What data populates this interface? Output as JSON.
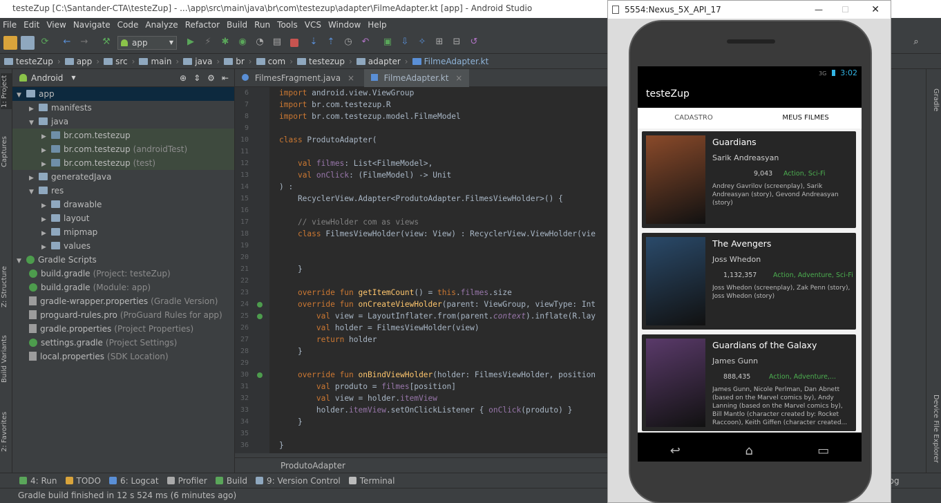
{
  "window": {
    "title": "testeZup [C:\\Santander-CTA\\testeZup] - ...\\app\\src\\main\\java\\br\\com\\testezup\\adapter\\FilmeAdapter.kt [app] - Android Studio",
    "minimize": "—",
    "maximize": "☐",
    "close": "✕"
  },
  "menu": [
    "File",
    "Edit",
    "View",
    "Navigate",
    "Code",
    "Analyze",
    "Refactor",
    "Build",
    "Run",
    "Tools",
    "VCS",
    "Window",
    "Help"
  ],
  "toolbar": {
    "run_config": "app"
  },
  "breadcrumb": [
    "testeZup",
    "app",
    "src",
    "main",
    "java",
    "br",
    "com",
    "testezup",
    "adapter",
    "FilmeAdapter.kt"
  ],
  "left_stripe": {
    "project": "1: Project",
    "captures": "Captures",
    "structure": "Z: Structure",
    "build_variants": "Build Variants",
    "favorites": "2: Favorites"
  },
  "project_panel": {
    "view_mode": "Android",
    "tree": [
      {
        "label": "app",
        "muted": "",
        "icon": "folder-icon",
        "indent": 0,
        "arrow": "▼"
      },
      {
        "label": "manifests",
        "muted": "",
        "icon": "folder-icon",
        "indent": 1,
        "arrow": "▶"
      },
      {
        "label": "java",
        "muted": "",
        "icon": "folder-icon",
        "indent": 1,
        "arrow": "▼"
      },
      {
        "label": "br.com.testezup",
        "muted": "",
        "icon": "package-icon",
        "indent": 2,
        "arrow": "▶"
      },
      {
        "label": "br.com.testezup",
        "muted": "(androidTest)",
        "icon": "package-icon",
        "indent": 2,
        "arrow": "▶"
      },
      {
        "label": "br.com.testezup",
        "muted": "(test)",
        "icon": "package-icon",
        "indent": 2,
        "arrow": "▶"
      },
      {
        "label": "generatedJava",
        "muted": "",
        "icon": "folder-icon",
        "indent": 1,
        "arrow": "▶"
      },
      {
        "label": "res",
        "muted": "",
        "icon": "folder-icon",
        "indent": 1,
        "arrow": "▼"
      },
      {
        "label": "drawable",
        "muted": "",
        "icon": "folder-icon",
        "indent": 2,
        "arrow": "▶"
      },
      {
        "label": "layout",
        "muted": "",
        "icon": "folder-icon",
        "indent": 2,
        "arrow": "▶"
      },
      {
        "label": "mipmap",
        "muted": "",
        "icon": "folder-icon",
        "indent": 2,
        "arrow": "▶"
      },
      {
        "label": "values",
        "muted": "",
        "icon": "folder-icon",
        "indent": 2,
        "arrow": "▶"
      },
      {
        "label": "Gradle Scripts",
        "muted": "",
        "icon": "gradle-icon",
        "indent": 0,
        "arrow": "▼"
      },
      {
        "label": "build.gradle",
        "muted": "(Project: testeZup)",
        "icon": "gradle-icon",
        "indent": 1,
        "arrow": ""
      },
      {
        "label": "build.gradle",
        "muted": "(Module: app)",
        "icon": "gradle-icon",
        "indent": 1,
        "arrow": ""
      },
      {
        "label": "gradle-wrapper.properties",
        "muted": "(Gradle Version)",
        "icon": "properties-icon",
        "indent": 1,
        "arrow": ""
      },
      {
        "label": "proguard-rules.pro",
        "muted": "(ProGuard Rules for app)",
        "icon": "properties-icon",
        "indent": 1,
        "arrow": ""
      },
      {
        "label": "gradle.properties",
        "muted": "(Project Properties)",
        "icon": "properties-icon",
        "indent": 1,
        "arrow": ""
      },
      {
        "label": "settings.gradle",
        "muted": "(Project Settings)",
        "icon": "gradle-icon",
        "indent": 1,
        "arrow": ""
      },
      {
        "label": "local.properties",
        "muted": "(SDK Location)",
        "icon": "properties-icon",
        "indent": 1,
        "arrow": ""
      }
    ]
  },
  "editor": {
    "tabs": [
      {
        "label": "FilmesFragment.java"
      },
      {
        "label": "FilmeAdapter.kt"
      }
    ],
    "close_glyph": "×",
    "line_numbers": [
      "6",
      "7",
      "8",
      "9",
      "10",
      "11",
      "12",
      "13",
      "14",
      "15",
      "16",
      "17",
      "18",
      "19",
      "20",
      "21",
      "22",
      "23",
      "24",
      "25",
      "26",
      "27",
      "28",
      "29",
      "30",
      "31",
      "32",
      "33",
      "34",
      "35",
      "36"
    ],
    "code": [
      [
        [
          "kw",
          "import "
        ],
        [
          "ty",
          "android.view.ViewGroup"
        ]
      ],
      [
        [
          "kw",
          "import "
        ],
        [
          "ty",
          "br.com.testezup.R"
        ]
      ],
      [
        [
          "kw",
          "import "
        ],
        [
          "ty",
          "br.com.testezup.model.FilmeModel"
        ]
      ],
      [],
      [
        [
          "kw",
          "class "
        ],
        [
          "ty",
          "ProdutoAdapter("
        ]
      ],
      [],
      [
        [
          "ty",
          "    "
        ],
        [
          "kw",
          "val "
        ],
        [
          "pr",
          "filmes"
        ],
        [
          "ty",
          ": List<FilmeModel>,"
        ]
      ],
      [
        [
          "ty",
          "    "
        ],
        [
          "kw",
          "val "
        ],
        [
          "pr",
          "onClick"
        ],
        [
          "ty",
          ": (FilmeModel) -> Unit"
        ]
      ],
      [
        [
          "ty",
          ") :"
        ]
      ],
      [
        [
          "ty",
          "    RecyclerView.Adapter<ProdutoAdapter.FilmesViewHolder>() {"
        ]
      ],
      [],
      [
        [
          "cm",
          "    // viewHolder com as views"
        ]
      ],
      [
        [
          "ty",
          "    "
        ],
        [
          "kw",
          "class "
        ],
        [
          "ty",
          "FilmesViewHolder(view: View) : RecyclerView.ViewHolder(vie"
        ]
      ],
      [],
      [],
      [
        [
          "ty",
          "    }"
        ]
      ],
      [],
      [
        [
          "ty",
          "    "
        ],
        [
          "kw",
          "override fun "
        ],
        [
          "fn",
          "getItemCount"
        ],
        [
          "ty",
          "() = "
        ],
        [
          "kw",
          "this"
        ],
        [
          "ty",
          "."
        ],
        [
          "pr",
          "filmes"
        ],
        [
          "ty",
          ".size"
        ]
      ],
      [
        [
          "ty",
          "    "
        ],
        [
          "kw",
          "override fun "
        ],
        [
          "fn",
          "onCreateViewHolder"
        ],
        [
          "ty",
          "(parent: ViewGroup, viewType: Int"
        ]
      ],
      [
        [
          "ty",
          "        "
        ],
        [
          "kw",
          "val "
        ],
        [
          "ty",
          "view = LayoutInflater.from(parent."
        ],
        [
          "it",
          "context"
        ],
        [
          "ty",
          ").inflate(R.lay"
        ]
      ],
      [
        [
          "ty",
          "        "
        ],
        [
          "kw",
          "val "
        ],
        [
          "ty",
          "holder = FilmesViewHolder(view)"
        ]
      ],
      [
        [
          "ty",
          "        "
        ],
        [
          "kw",
          "return "
        ],
        [
          "ty",
          "holder"
        ]
      ],
      [
        [
          "ty",
          "    }"
        ]
      ],
      [],
      [
        [
          "ty",
          "    "
        ],
        [
          "kw",
          "override fun "
        ],
        [
          "fn",
          "onBindViewHolder"
        ],
        [
          "ty",
          "(holder: FilmesViewHolder, position"
        ]
      ],
      [
        [
          "ty",
          "        "
        ],
        [
          "kw",
          "val "
        ],
        [
          "ty",
          "produto = "
        ],
        [
          "pr",
          "filmes"
        ],
        [
          "ty",
          "[position]"
        ]
      ],
      [
        [
          "ty",
          "        "
        ],
        [
          "kw",
          "val "
        ],
        [
          "ty",
          "view = holder."
        ],
        [
          "pr",
          "itemView"
        ]
      ],
      [
        [
          "ty",
          "        holder."
        ],
        [
          "pr",
          "itemView"
        ],
        [
          "ty",
          ".setOnClickListener { "
        ],
        [
          "pr",
          "onClick"
        ],
        [
          "ty",
          "(produto) }"
        ]
      ],
      [
        [
          "ty",
          "    }"
        ]
      ],
      [],
      [
        [
          "ty",
          "}"
        ]
      ]
    ],
    "footer": "ProdutoAdapter"
  },
  "bottom_tabs": [
    "4: Run",
    "TODO",
    "6: Logcat",
    "Profiler",
    "Build",
    "9: Version Control",
    "Terminal"
  ],
  "event_log": "Event Log",
  "status": "Gradle build finished in 12 s 524 ms (6 minutes ago)",
  "right_stripe": {
    "gradle": "Gradle",
    "device_explorer": "Device File Explorer"
  },
  "emulator": {
    "title": "5554:Nexus_5X_API_17",
    "clock": "3:02",
    "signal": "3G",
    "app_title": "testeZup",
    "tabs": [
      "CADASTRO",
      "MEUS FILMES"
    ],
    "accent": "#c62828",
    "movies": [
      {
        "title": "Guardians",
        "director": "Sarik Andreasyan",
        "votes": "9,043",
        "genres": "Action, Sci-Fi",
        "writers": "Andrey Gavrilov (screenplay), Sarik Andreasyan (story), Gevond Andreasyan (story)",
        "poster_color": "#8a4a2a"
      },
      {
        "title": "The Avengers",
        "director": "Joss Whedon",
        "votes": "1,132,357",
        "genres": "Action, Adventure, Sci-Fi",
        "writers": "Joss Whedon (screenplay), Zak Penn (story), Joss Whedon (story)",
        "poster_color": "#2a4a6a"
      },
      {
        "title": "Guardians of the Galaxy",
        "director": "James Gunn",
        "votes": "888,435",
        "genres": "Action, Adventure,...",
        "writers": "James Gunn, Nicole Perlman, Dan Abnett (based on the Marvel comics by), Andy Lanning (based on the Marvel comics by), Bill Mantlo (character created by: Rocket Raccoon), Keith Giffen (character created...",
        "poster_color": "#5a3a6a"
      }
    ],
    "nav": {
      "back": "↩",
      "home": "⌂",
      "recents": "▭"
    }
  }
}
